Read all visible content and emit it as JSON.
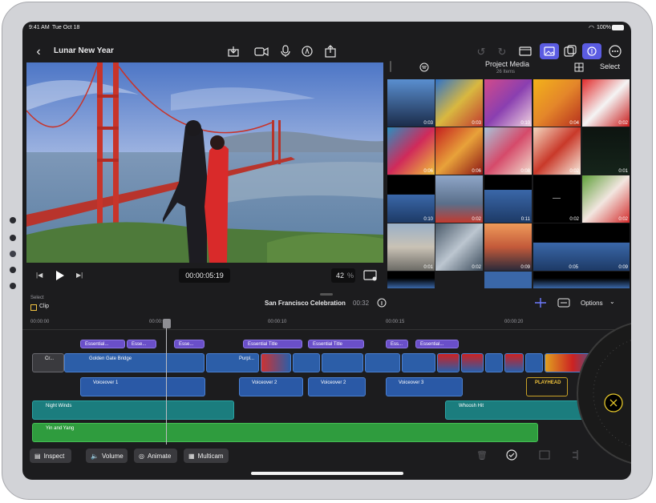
{
  "status": {
    "time": "9:41 AM",
    "date": "Tue Oct 18",
    "battery": "100%"
  },
  "toolbar": {
    "project_title": "Lunar New Year"
  },
  "viewer": {
    "timecode": "00:00:05:19",
    "zoom": "42",
    "zoom_unit": "%"
  },
  "media": {
    "title": "Project Media",
    "count": "26 Items",
    "select_label": "Select",
    "durations": [
      "0:03",
      "0:03",
      "0:10",
      "0:04",
      "0:02",
      "0:06",
      "0:06",
      "0:08",
      "0:02",
      "0:01",
      "0:10",
      "0:02",
      "0:11",
      "0:02",
      "0:02",
      "0:01",
      "0:02",
      "0:09",
      "0:05",
      "0:09"
    ]
  },
  "timeline": {
    "select_label": "Select",
    "mode_label": "Clip",
    "project_name": "San Francisco Celebration",
    "duration": "00:32",
    "options_label": "Options",
    "ruler": [
      "00:00:00",
      "00:00:05",
      "00:00:10",
      "00:00:15",
      "00:00:20"
    ],
    "titles": [
      "Essential...",
      "Esse...",
      "Esse...",
      "Essential Title",
      "Essential Title",
      "Ess...",
      "Essential..."
    ],
    "primary": {
      "cr": "Cr...",
      "golden": "Golden Gate Bridge",
      "purple": "Purpl..."
    },
    "voiceovers": [
      "Voiceover 1",
      "Voiceover 2",
      "Voiceover 2",
      "Voiceover 3"
    ],
    "playhead_label": "PLAYHEAD",
    "audio": {
      "night": "Night Winds",
      "whoosh": "Whoosh Hit",
      "yin": "Yin and Yang"
    }
  },
  "bottom": {
    "inspect": "Inspect",
    "volume": "Volume",
    "animate": "Animate",
    "multicam": "Multicam"
  }
}
